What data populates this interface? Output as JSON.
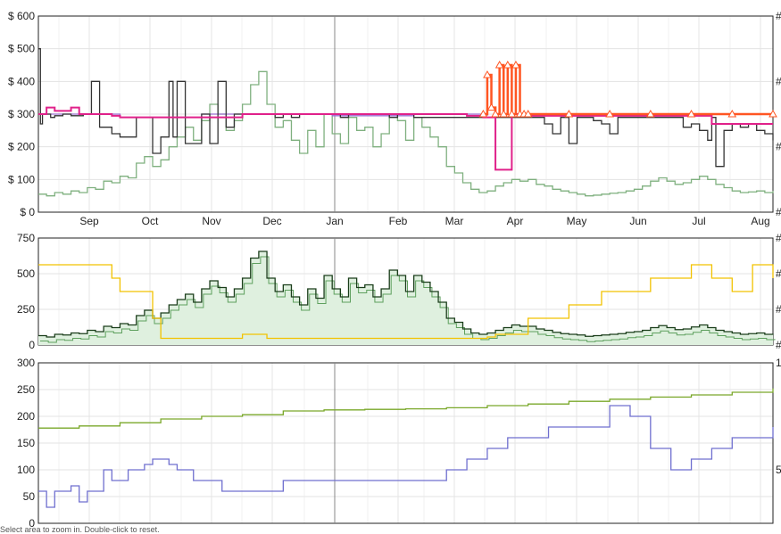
{
  "chart_data": [
    {
      "type": "line",
      "y_tick_labels": [
        "$ 0",
        "$ 100",
        "$ 200",
        "$ 300",
        "$ 400",
        "$ 500",
        "$ 600"
      ],
      "ylim": [
        0,
        600
      ],
      "x_tick_labels": [
        "Sep",
        "Oct",
        "Nov",
        "Dec",
        "Jan",
        "Feb",
        "Mar",
        "Apr",
        "May",
        "Jun",
        "Jul",
        "Aug"
      ],
      "grid": true,
      "colors": {
        "used": "#333333",
        "new_3p": "#e0218a",
        "amazon": "#ff5522",
        "sales_rank": "#7fb07f",
        "list_price": "#9a6fd0"
      },
      "series": [
        {
          "key": "sales_rank",
          "x": [
            0,
            4,
            8,
            12,
            16,
            20,
            24,
            28,
            32,
            36,
            40,
            44,
            48,
            52,
            56,
            60,
            64,
            68,
            72,
            76,
            80,
            84,
            88,
            92,
            96,
            100,
            104,
            108,
            112,
            116,
            120,
            124,
            128,
            132,
            136,
            140,
            144,
            148,
            152,
            156,
            160,
            164,
            168,
            172,
            176,
            180,
            184,
            188,
            192,
            196,
            200,
            204,
            208,
            212,
            216,
            220,
            224,
            228,
            232,
            236,
            240,
            244,
            248,
            252,
            256,
            260,
            264,
            268,
            272,
            276,
            280,
            284,
            288,
            292,
            296,
            300,
            304,
            308,
            312,
            316,
            320,
            324,
            328,
            332,
            336,
            340,
            344,
            348,
            352,
            356,
            360
          ],
          "values": [
            55,
            50,
            60,
            55,
            65,
            60,
            75,
            70,
            95,
            90,
            110,
            105,
            150,
            170,
            140,
            160,
            200,
            230,
            260,
            220,
            280,
            330,
            300,
            250,
            280,
            330,
            390,
            430,
            330,
            260,
            280,
            220,
            180,
            250,
            200,
            300,
            240,
            210,
            290,
            250,
            260,
            200,
            240,
            300,
            280,
            220,
            290,
            260,
            230,
            200,
            140,
            120,
            90,
            70,
            60,
            65,
            80,
            90,
            100,
            95,
            100,
            85,
            80,
            70,
            65,
            60,
            55,
            50,
            52,
            55,
            58,
            60,
            65,
            70,
            80,
            95,
            105,
            95,
            85,
            90,
            100,
            110,
            100,
            85,
            75,
            65,
            60,
            62,
            65,
            60,
            65
          ]
        },
        {
          "key": "list_price",
          "x": [
            0,
            20,
            36,
            40,
            76,
            80,
            120,
            124,
            140,
            144,
            180,
            184,
            216,
            220
          ],
          "values": [
            300,
            300,
            300,
            290,
            290,
            300,
            300,
            300,
            300,
            295,
            295,
            300,
            300,
            295
          ]
        },
        {
          "key": "used",
          "x": [
            0,
            1,
            2,
            6,
            8,
            12,
            16,
            22,
            26,
            30,
            36,
            40,
            48,
            52,
            56,
            60,
            64,
            66,
            68,
            72,
            76,
            80,
            82,
            84,
            86,
            88,
            92,
            96,
            100,
            104,
            108,
            112,
            116,
            120,
            124,
            128,
            132,
            136,
            140,
            144,
            148,
            152,
            156,
            160,
            164,
            168,
            172,
            176,
            180,
            184,
            188,
            192,
            196,
            200,
            204,
            208,
            212,
            216,
            220,
            224,
            228,
            232,
            236,
            240,
            244,
            248,
            252,
            256,
            260,
            264,
            268,
            272,
            276,
            280,
            284,
            288,
            292,
            296,
            300,
            304,
            308,
            312,
            316,
            320,
            324,
            328,
            330,
            332,
            336,
            340,
            344,
            348,
            352,
            356,
            360
          ],
          "values": [
            500,
            270,
            300,
            290,
            295,
            300,
            295,
            300,
            400,
            260,
            240,
            230,
            290,
            290,
            180,
            230,
            400,
            230,
            400,
            210,
            210,
            300,
            300,
            210,
            210,
            400,
            260,
            300,
            300,
            300,
            300,
            300,
            290,
            300,
            290,
            300,
            300,
            300,
            300,
            300,
            290,
            300,
            300,
            300,
            300,
            300,
            290,
            300,
            300,
            290,
            290,
            290,
            290,
            290,
            290,
            290,
            290,
            290,
            290,
            290,
            290,
            290,
            290,
            290,
            290,
            270,
            240,
            290,
            210,
            290,
            290,
            280,
            270,
            240,
            290,
            290,
            290,
            290,
            290,
            290,
            290,
            290,
            260,
            270,
            250,
            220,
            290,
            140,
            250,
            270,
            260,
            270,
            250,
            240,
            220
          ]
        },
        {
          "key": "new_3p",
          "x": [
            0,
            4,
            8,
            12,
            16,
            20,
            24,
            28,
            32,
            36,
            40,
            48,
            60,
            80,
            100,
            120,
            140,
            160,
            180,
            200,
            210,
            214,
            218,
            222,
            224,
            226,
            232,
            240,
            280,
            320,
            330,
            360
          ],
          "values": [
            300,
            320,
            310,
            310,
            320,
            300,
            300,
            300,
            300,
            295,
            290,
            290,
            290,
            290,
            300,
            300,
            300,
            300,
            300,
            300,
            295,
            295,
            290,
            290,
            130,
            130,
            300,
            295,
            295,
            295,
            270,
            270
          ]
        },
        {
          "key": "amazon",
          "x": [
            218,
            220,
            222,
            224,
            226,
            228,
            230,
            232,
            234,
            236,
            238,
            240,
            260,
            280,
            300,
            320,
            340,
            360
          ],
          "values": [
            300,
            420,
            320,
            300,
            450,
            300,
            450,
            300,
            450,
            300,
            300,
            300,
            300,
            300,
            300,
            300,
            300,
            300
          ],
          "markers": true
        }
      ]
    },
    {
      "type": "area",
      "y_tick_labels": [
        "0",
        "250",
        "500",
        "750"
      ],
      "ylim": [
        0,
        800
      ],
      "grid": true,
      "colors": {
        "rank_main": "#1a3d1a",
        "rank_fill": "#dff0df",
        "rank_light": "#5ea05e",
        "offers": "#f2c200"
      },
      "series": [
        {
          "key": "rank_main",
          "x": [
            0,
            4,
            8,
            12,
            16,
            20,
            24,
            28,
            32,
            36,
            40,
            44,
            48,
            52,
            56,
            60,
            64,
            68,
            72,
            76,
            80,
            84,
            88,
            92,
            96,
            100,
            104,
            108,
            112,
            116,
            120,
            124,
            128,
            132,
            136,
            140,
            144,
            148,
            152,
            156,
            160,
            164,
            168,
            172,
            176,
            180,
            184,
            188,
            192,
            196,
            200,
            204,
            208,
            212,
            216,
            220,
            224,
            228,
            232,
            236,
            240,
            244,
            248,
            252,
            256,
            260,
            264,
            268,
            272,
            276,
            280,
            284,
            288,
            292,
            296,
            300,
            304,
            308,
            312,
            316,
            320,
            324,
            328,
            332,
            336,
            340,
            344,
            348,
            352,
            356,
            360
          ],
          "values": [
            70,
            60,
            80,
            75,
            90,
            85,
            110,
            100,
            140,
            130,
            160,
            150,
            220,
            260,
            200,
            240,
            300,
            340,
            380,
            320,
            420,
            480,
            430,
            360,
            420,
            500,
            650,
            700,
            500,
            400,
            450,
            360,
            300,
            420,
            350,
            520,
            420,
            360,
            500,
            430,
            450,
            360,
            420,
            560,
            520,
            400,
            520,
            470,
            400,
            320,
            200,
            170,
            120,
            90,
            80,
            90,
            110,
            130,
            150,
            140,
            140,
            120,
            110,
            95,
            85,
            80,
            75,
            65,
            70,
            75,
            80,
            85,
            95,
            100,
            110,
            130,
            145,
            130,
            115,
            120,
            135,
            150,
            130,
            110,
            100,
            90,
            80,
            85,
            90,
            80,
            85
          ]
        },
        {
          "key": "offers",
          "x": [
            0,
            20,
            36,
            40,
            56,
            60,
            80,
            100,
            112,
            130,
            140,
            150,
            160,
            180,
            200,
            210,
            220,
            224,
            240,
            260,
            276,
            280,
            300,
            320,
            330,
            340,
            346,
            350,
            360
          ],
          "values": [
            600,
            600,
            500,
            400,
            200,
            50,
            50,
            80,
            50,
            50,
            50,
            50,
            50,
            50,
            50,
            50,
            60,
            80,
            200,
            300,
            400,
            400,
            500,
            600,
            500,
            400,
            400,
            600,
            500
          ]
        }
      ]
    },
    {
      "type": "line",
      "y_tick_labels": [
        "0",
        "50",
        "100",
        "150",
        "200",
        "250",
        "300"
      ],
      "ylim": [
        0,
        300
      ],
      "grid": true,
      "colors": {
        "offer_count": "#6f6fcf",
        "rating_count": "#7aa82a"
      },
      "series": [
        {
          "key": "rating_count",
          "x": [
            0,
            20,
            40,
            60,
            80,
            100,
            120,
            140,
            160,
            180,
            200,
            220,
            240,
            260,
            280,
            300,
            320,
            340,
            360
          ],
          "values": [
            178,
            182,
            188,
            195,
            200,
            203,
            210,
            212,
            213,
            214,
            216,
            220,
            223,
            228,
            232,
            236,
            240,
            245,
            252
          ]
        },
        {
          "key": "offer_count",
          "x": [
            0,
            4,
            8,
            12,
            16,
            20,
            24,
            28,
            32,
            36,
            40,
            44,
            48,
            52,
            56,
            60,
            64,
            68,
            72,
            76,
            80,
            90,
            100,
            110,
            120,
            130,
            140,
            150,
            160,
            170,
            180,
            190,
            200,
            210,
            220,
            230,
            240,
            250,
            260,
            270,
            280,
            290,
            300,
            310,
            320,
            330,
            340,
            350,
            360
          ],
          "values": [
            60,
            30,
            60,
            60,
            70,
            40,
            60,
            60,
            100,
            80,
            80,
            100,
            100,
            110,
            120,
            120,
            110,
            100,
            100,
            80,
            80,
            60,
            60,
            60,
            80,
            80,
            80,
            80,
            80,
            80,
            80,
            80,
            100,
            120,
            140,
            160,
            160,
            180,
            180,
            180,
            220,
            200,
            140,
            100,
            120,
            140,
            160,
            160,
            180
          ]
        }
      ]
    }
  ],
  "footer_note": "Select area to zoom in. Double-click to reset."
}
